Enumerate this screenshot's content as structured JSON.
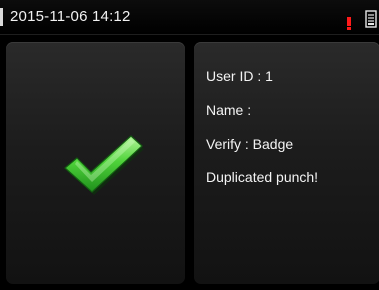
{
  "status_bar": {
    "datetime": "2015-11-06 14:12",
    "alert_color": "#ff1a1a",
    "icons": [
      "alert-icon",
      "device-icon"
    ]
  },
  "result": {
    "icon": "checkmark-icon",
    "accent": "#3fce32"
  },
  "info": {
    "user_id": "User ID : 1",
    "name": "Name :",
    "verify": "Verify : Badge",
    "message": "Duplicated punch!"
  }
}
